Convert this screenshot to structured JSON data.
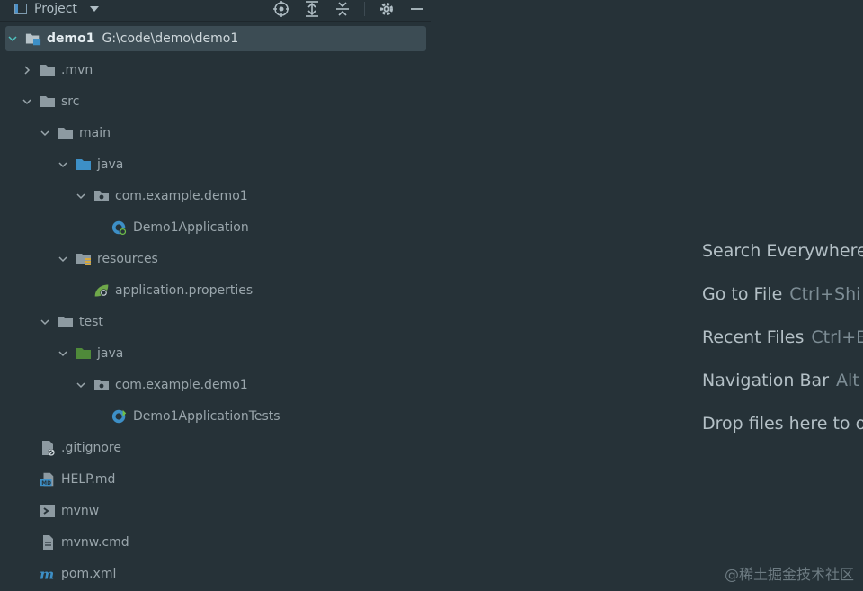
{
  "toolbar": {
    "title": "Project",
    "icons": [
      "locate-icon",
      "expand-all-icon",
      "collapse-all-icon",
      "gear-icon",
      "minimize-icon"
    ]
  },
  "tree": [
    {
      "name": "demo1",
      "path": "G:\\code\\demo\\demo1",
      "icon": "module-folder-icon",
      "expanded": true,
      "depth": 0,
      "selected": true
    },
    {
      "name": ".mvn",
      "icon": "folder-icon",
      "expanded": false,
      "depth": 1
    },
    {
      "name": "src",
      "icon": "folder-icon",
      "expanded": true,
      "depth": 1
    },
    {
      "name": "main",
      "icon": "folder-icon",
      "expanded": true,
      "depth": 2
    },
    {
      "name": "java",
      "icon": "source-folder-icon",
      "expanded": true,
      "depth": 3
    },
    {
      "name": "com.example.demo1",
      "icon": "package-icon",
      "expanded": true,
      "depth": 4
    },
    {
      "name": "Demo1Application",
      "icon": "spring-class-icon",
      "depth": 5
    },
    {
      "name": "resources",
      "icon": "resources-folder-icon",
      "expanded": true,
      "depth": 3
    },
    {
      "name": "application.properties",
      "icon": "spring-properties-icon",
      "depth": 4
    },
    {
      "name": "test",
      "icon": "folder-icon",
      "expanded": true,
      "depth": 2
    },
    {
      "name": "java",
      "icon": "test-folder-icon",
      "expanded": true,
      "depth": 3
    },
    {
      "name": "com.example.demo1",
      "icon": "package-icon",
      "expanded": true,
      "depth": 4
    },
    {
      "name": "Demo1ApplicationTests",
      "icon": "test-class-icon",
      "depth": 5
    },
    {
      "name": ".gitignore",
      "icon": "gitignore-icon",
      "depth": 1
    },
    {
      "name": "HELP.md",
      "icon": "markdown-icon",
      "depth": 1
    },
    {
      "name": "mvnw",
      "icon": "shell-icon",
      "depth": 1
    },
    {
      "name": "mvnw.cmd",
      "icon": "file-icon",
      "depth": 1
    },
    {
      "name": "pom.xml",
      "icon": "maven-icon",
      "depth": 1
    }
  ],
  "hints": [
    {
      "label": "Search Everywhere",
      "key": ""
    },
    {
      "label": "Go to File",
      "key": "Ctrl+Shi"
    },
    {
      "label": "Recent Files",
      "key": "Ctrl+E"
    },
    {
      "label": "Navigation Bar",
      "key": "Alt"
    },
    {
      "label": "Drop files here to o",
      "key": ""
    }
  ],
  "watermark": "@稀土掘金技术社区",
  "colors": {
    "background": "#263238",
    "selection": "#3c4c54",
    "text": "#9aa6ac",
    "source_folder": "#3d8fc6",
    "test_folder": "#4f8a3a"
  }
}
